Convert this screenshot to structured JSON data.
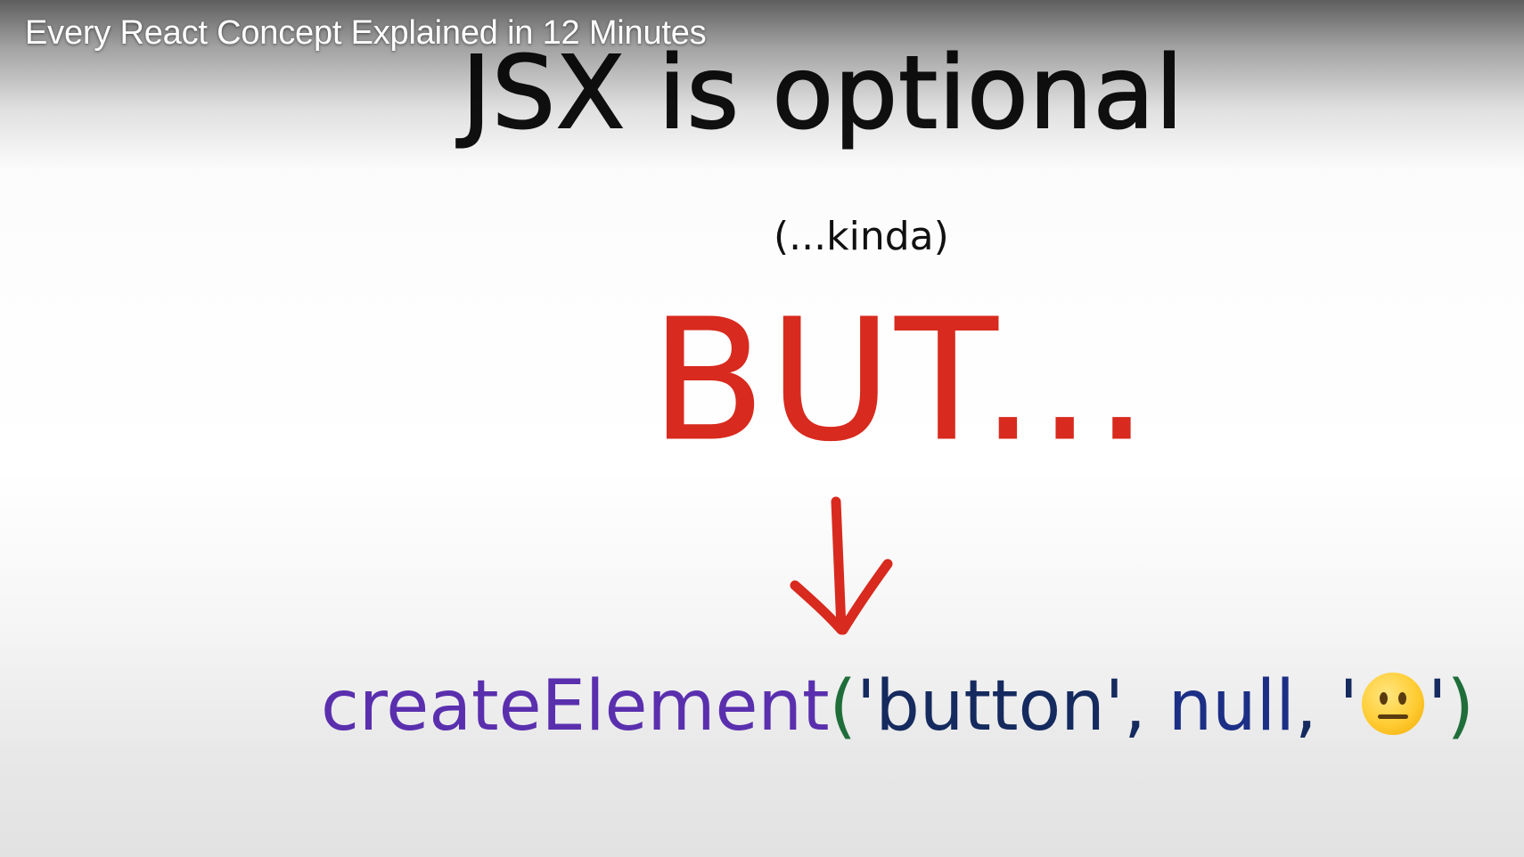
{
  "video": {
    "title": "Every React Concept Explained in 12 Minutes"
  },
  "slide": {
    "heading": "JSX is optional",
    "subheading": "(...kinda)",
    "emphasis": "BUT...",
    "code": {
      "function_name": "createElement",
      "open_paren": "(",
      "arg1": "'button'",
      "sep1": ",",
      "arg2": "null",
      "sep2": ",",
      "quote_open": "'",
      "emoji_icon": "neutral-face-emoji",
      "quote_close": "'",
      "close_paren": ")"
    }
  },
  "colors": {
    "heading": "#111111",
    "emphasis_red": "#d82a1e",
    "code_function": "#5a2fae",
    "code_paren": "#1f6e3a",
    "code_string": "#152a5e",
    "code_null": "#1c2f86"
  }
}
